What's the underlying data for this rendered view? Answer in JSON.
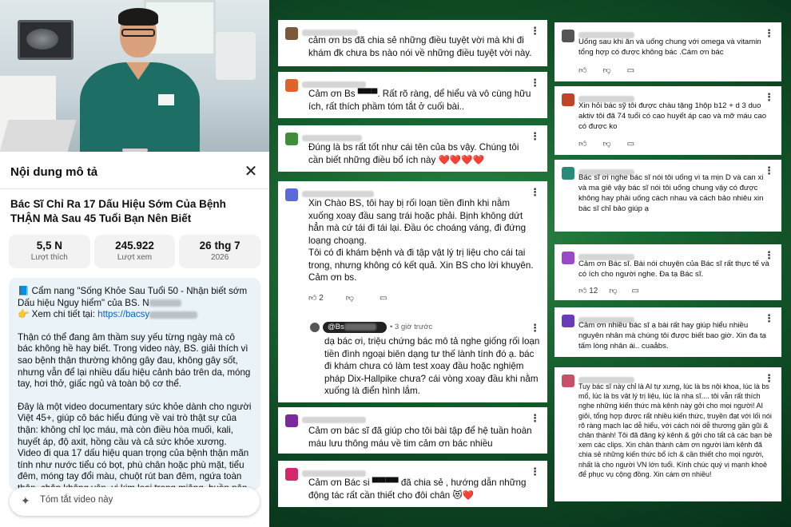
{
  "video": {
    "title": "Bác Sĩ Chỉ Ra 17 Dấu Hiệu Sớm Của Bệnh THẬN Mà Sau 45 Tuổi Bạn Nên Biết"
  },
  "panel": {
    "title": "Nội dung mô tả",
    "close_icon": "close-icon"
  },
  "stats": [
    {
      "value": "5,5 N",
      "label": "Lượt thích"
    },
    {
      "value": "245.922",
      "label": "Lượt xem"
    },
    {
      "value": "26 thg 7",
      "label": "2026"
    }
  ],
  "description": {
    "line1": "📘 Cẩm nang \"Sống Khỏe Sau Tuổi 50 - Nhận biết sớm Dấu hiệu Nguy hiểm\" của BS. N",
    "line2_prefix": "👉 Xem chi tiết tại: ",
    "line2_link": "https://bacsy",
    "para2": "Thận có thể đang âm thầm suy yếu từng ngày mà cô bác không hề hay biết. Trong video này, BS. giải thích vì sao bệnh thận thường không gây đau, không gây sốt, nhưng vẫn để lại nhiều dấu hiệu cảnh báo trên da, móng tay, hơi thở, giấc ngủ và toàn bộ cơ thể.",
    "para3": "Đây là một video documentary sức khỏe dành cho người Việt 45+, giúp cô bác hiểu đúng về vai trò thật sự của thận: không chỉ lọc máu, mà còn điều hòa muối, kali, huyết áp, độ axit, hồng cầu và cả sức khỏe xương. Video đi qua 17 dấu hiệu quan trọng của bệnh thận mãn tính như nước tiểu có bọt, phù chân hoặc phù mặt, tiểu đêm, móng tay đổi màu, chuột rút ban đêm, ngứa toàn thân, chân không yên, vị kim loại trong miệng, buồn nôn, sụt"
  },
  "summarize": {
    "placeholder": "Tóm tắt video này"
  },
  "comments_left": [
    {
      "text": "cảm ơn bs đã chia sẻ những điều tuyệt vời mà khi đi khám đk chưa bs nào nói về những điều tuyệt vời này.",
      "avatar_color": "#7a5a3a"
    },
    {
      "text": "Cảm ơn Bs ▀▀▀. Rất rõ ràng,  dể hiểu và vô cùng hữu ích, rất thích phầm tóm tắt ở cuối bài..",
      "avatar_color": "#e0642a"
    },
    {
      "text": "Đúng là bs rất tốt như cái tên của bs vậy. Chúng tôi cần biết những điều bổ ích này ❤️❤️❤️❤️",
      "avatar_color": "#3f8f3a"
    },
    {
      "text": "Xin Chào BS,  tôi hay bị rối loạn tiền đình khi nằm xuống xoay đầu sang trái hoặc phải. Bịnh không dứt hẳn mà cứ tái đi tái lại. Đầu óc choáng váng, đi đứng loạng choạng.\nTôi có đi khám bệnh và đi tập vật  lý trị liệu cho cái tai trong, nhưng không có kết quả. Xin BS cho lời khuyên.\nCảm ơn bs.",
      "avatar_color": "#5a6ad8",
      "likes": "2"
    },
    {
      "text": "Cảm ơn bác sĩ đã giúp cho tôi bài tập để hệ tuần hoàn máu lưu thông máu về tim cảm ơn bác nhiều",
      "avatar_color": "#7a2a9a"
    },
    {
      "text": "Cảm ơn Bác si ▀▀▀▀ đã chia sẻ , hướng dẫn những động tác rất cần thiết cho đôi chân 😻❤️",
      "avatar_color": "#d02a6a"
    }
  ],
  "reply": {
    "handle": "@Bs",
    "time": "• 3 giờ trước",
    "text": "dạ bác ơi, triệu chứng bác mô tả nghe giống rối loạn tiền đình ngoại biên dạng tư thế lành tính đó ạ. bác đi khám chưa có làm test xoay đầu hoặc nghiệm pháp Dix-Hallpike chưa? cái vòng xoay đầu khi nằm xuống là điển hình lắm."
  },
  "comments_right": [
    {
      "text": "Uống sau khi ăn và uống chung với omega và vitamin tổng hợp có được không bác .Cám ơn bác",
      "avatar_color": "#555555"
    },
    {
      "text": "Xin hỏi bác sỹ tôi được chàu tặng 1hộp b12 + d 3  duo aktiv  tôi đã 74 tuổi  có cao huyết áp cao và mỡ máu cao có được ko",
      "avatar_color": "#c0442a"
    },
    {
      "text": "Bác sĩ ơi nghe bác sĩ nói tôi uống vì ta mịn D và can xi và ma giê  vậy bác sĩ nói tôi uống chung vậy có được không hay phải uống cách nhau và cách bảo nhiêu xin bác sĩ chỉ bảo giúp ạ",
      "avatar_color": "#2a8a7a"
    },
    {
      "text": "Cảm ơn Bác sĩ. Bài nói chuyện của Bác sĩ rất thực tế và có ích cho người nghe. Đa tạ Bác sĩ.",
      "avatar_color": "#9a4ac8",
      "likes": "12"
    },
    {
      "text": "Cảm ơn nhiều bác sĩ ạ bài rất hay giúp hiểu nhiều nguyên nhân mà chúng tôi được biết bao giờ. Xin đa tạ tấm lòng nhân ái.. cuaåbs.",
      "avatar_color": "#6a3ab8"
    },
    {
      "text": "Tuy bác sĩ này chỉ là AI tự xưng, lúc là bs nội khoa, lúc là bs mổ, lúc là bs vật lý trị liệu, lúc là nha sĩ.... tôi vẫn rất thích nghe những kiến thức mà kênh này gởi cho mọi người!  AI giỏi, tổng hợp được rất nhiều kiến thức, truyền đạt với lối nói rõ ràng mạch lạc dễ hiểu, với cách nói dễ thương gần gũi & chân thành! Tôi đã đăng ký kênh & gởi cho tất cả các bạn bè xem các clips.  Xin chân thành cảm ơn người làm kênh đã chia sẻ những kiến thức bổ ích & cần thiết cho mọi người, nhất là cho người VN lớn tuổi.  Kính chúc quý vị mạnh khoẻ để phục vụ cộng đồng. Xin cám ơn nhiều!",
      "avatar_color": "#c8506a"
    }
  ],
  "icons": {
    "like": "thumb-up-icon",
    "dislike": "thumb-down-icon",
    "reply": "comment-icon",
    "more": "more-vert-icon"
  }
}
